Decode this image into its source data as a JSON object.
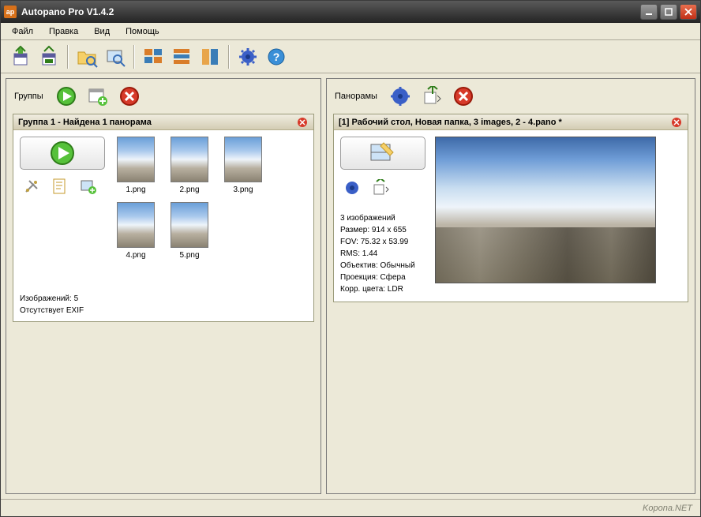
{
  "window": {
    "title": "Autopano Pro V1.4.2"
  },
  "menu": {
    "file": "Файл",
    "edit": "Правка",
    "view": "Вид",
    "help": "Помощь"
  },
  "panes": {
    "groups": {
      "label": "Группы"
    },
    "panoramas": {
      "label": "Панорамы"
    }
  },
  "group_card": {
    "title": "Группа 1 - Найдена 1 панорама",
    "thumbs": [
      "1.png",
      "2.png",
      "3.png",
      "4.png",
      "5.png"
    ],
    "foot_count": "Изображений: 5",
    "foot_exif": "Отсутствует EXIF"
  },
  "pano_card": {
    "title": "[1] Рабочий стол, Новая папка, 3 images, 2 - 4.pano *",
    "info_images": "3 изображений",
    "info_size": "Размер: 914 x 655",
    "info_fov": "FOV: 75.32 x 53.99",
    "info_rms": "RMS: 1.44",
    "info_lens": "Объектив: Обычный",
    "info_proj": "Проекция: Сфера",
    "info_color": "Корр. цвета: LDR"
  },
  "status": {
    "watermark": "Kopona.NET"
  }
}
